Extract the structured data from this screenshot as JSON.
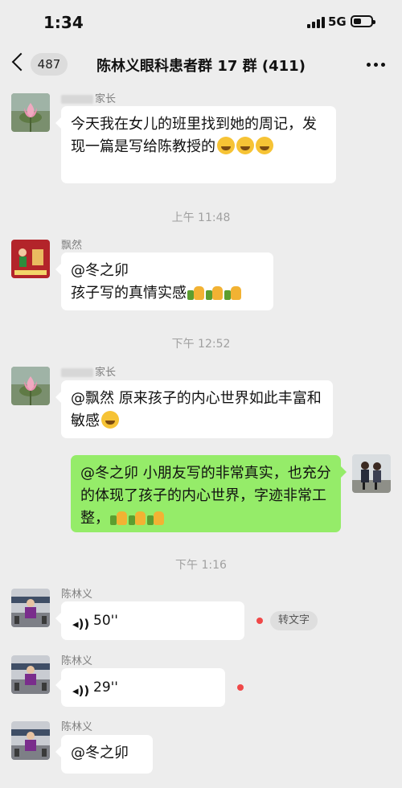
{
  "status_bar": {
    "time": "1:34",
    "network": "5G"
  },
  "header": {
    "unread_count": "487",
    "title": "陈林义眼科患者群 17 群 (411)"
  },
  "messages": [
    {
      "sender_name": "家长",
      "text": "今天我在女儿的班里找到她的周记，发现一篇是写给陈教授的"
    },
    {
      "timestamp": "上午 11:48"
    },
    {
      "sender_name": "飘然",
      "mention": "@冬之卯",
      "text": "孩子写的真情实感"
    },
    {
      "timestamp": "下午 12:52"
    },
    {
      "sender_name": "家长",
      "text": "@飘然 原来孩子的内心世界如此丰富和敏感"
    },
    {
      "text": "@冬之卯 小朋友写的非常真实，也充分的体现了孩子的内心世界，字迹非常工整，",
      "from_me": true
    },
    {
      "timestamp": "下午 1:16"
    },
    {
      "sender_name": "陈林义",
      "voice_duration": "50''",
      "transcribe_label": "转文字"
    },
    {
      "sender_name": "陈林义",
      "voice_duration": "29''"
    },
    {
      "sender_name": "陈林义",
      "text": "@冬之卯"
    }
  ],
  "colors": {
    "background": "#ededed",
    "my_bubble": "#95ec69",
    "other_bubble": "#ffffff",
    "unread_dot": "#f04848"
  }
}
